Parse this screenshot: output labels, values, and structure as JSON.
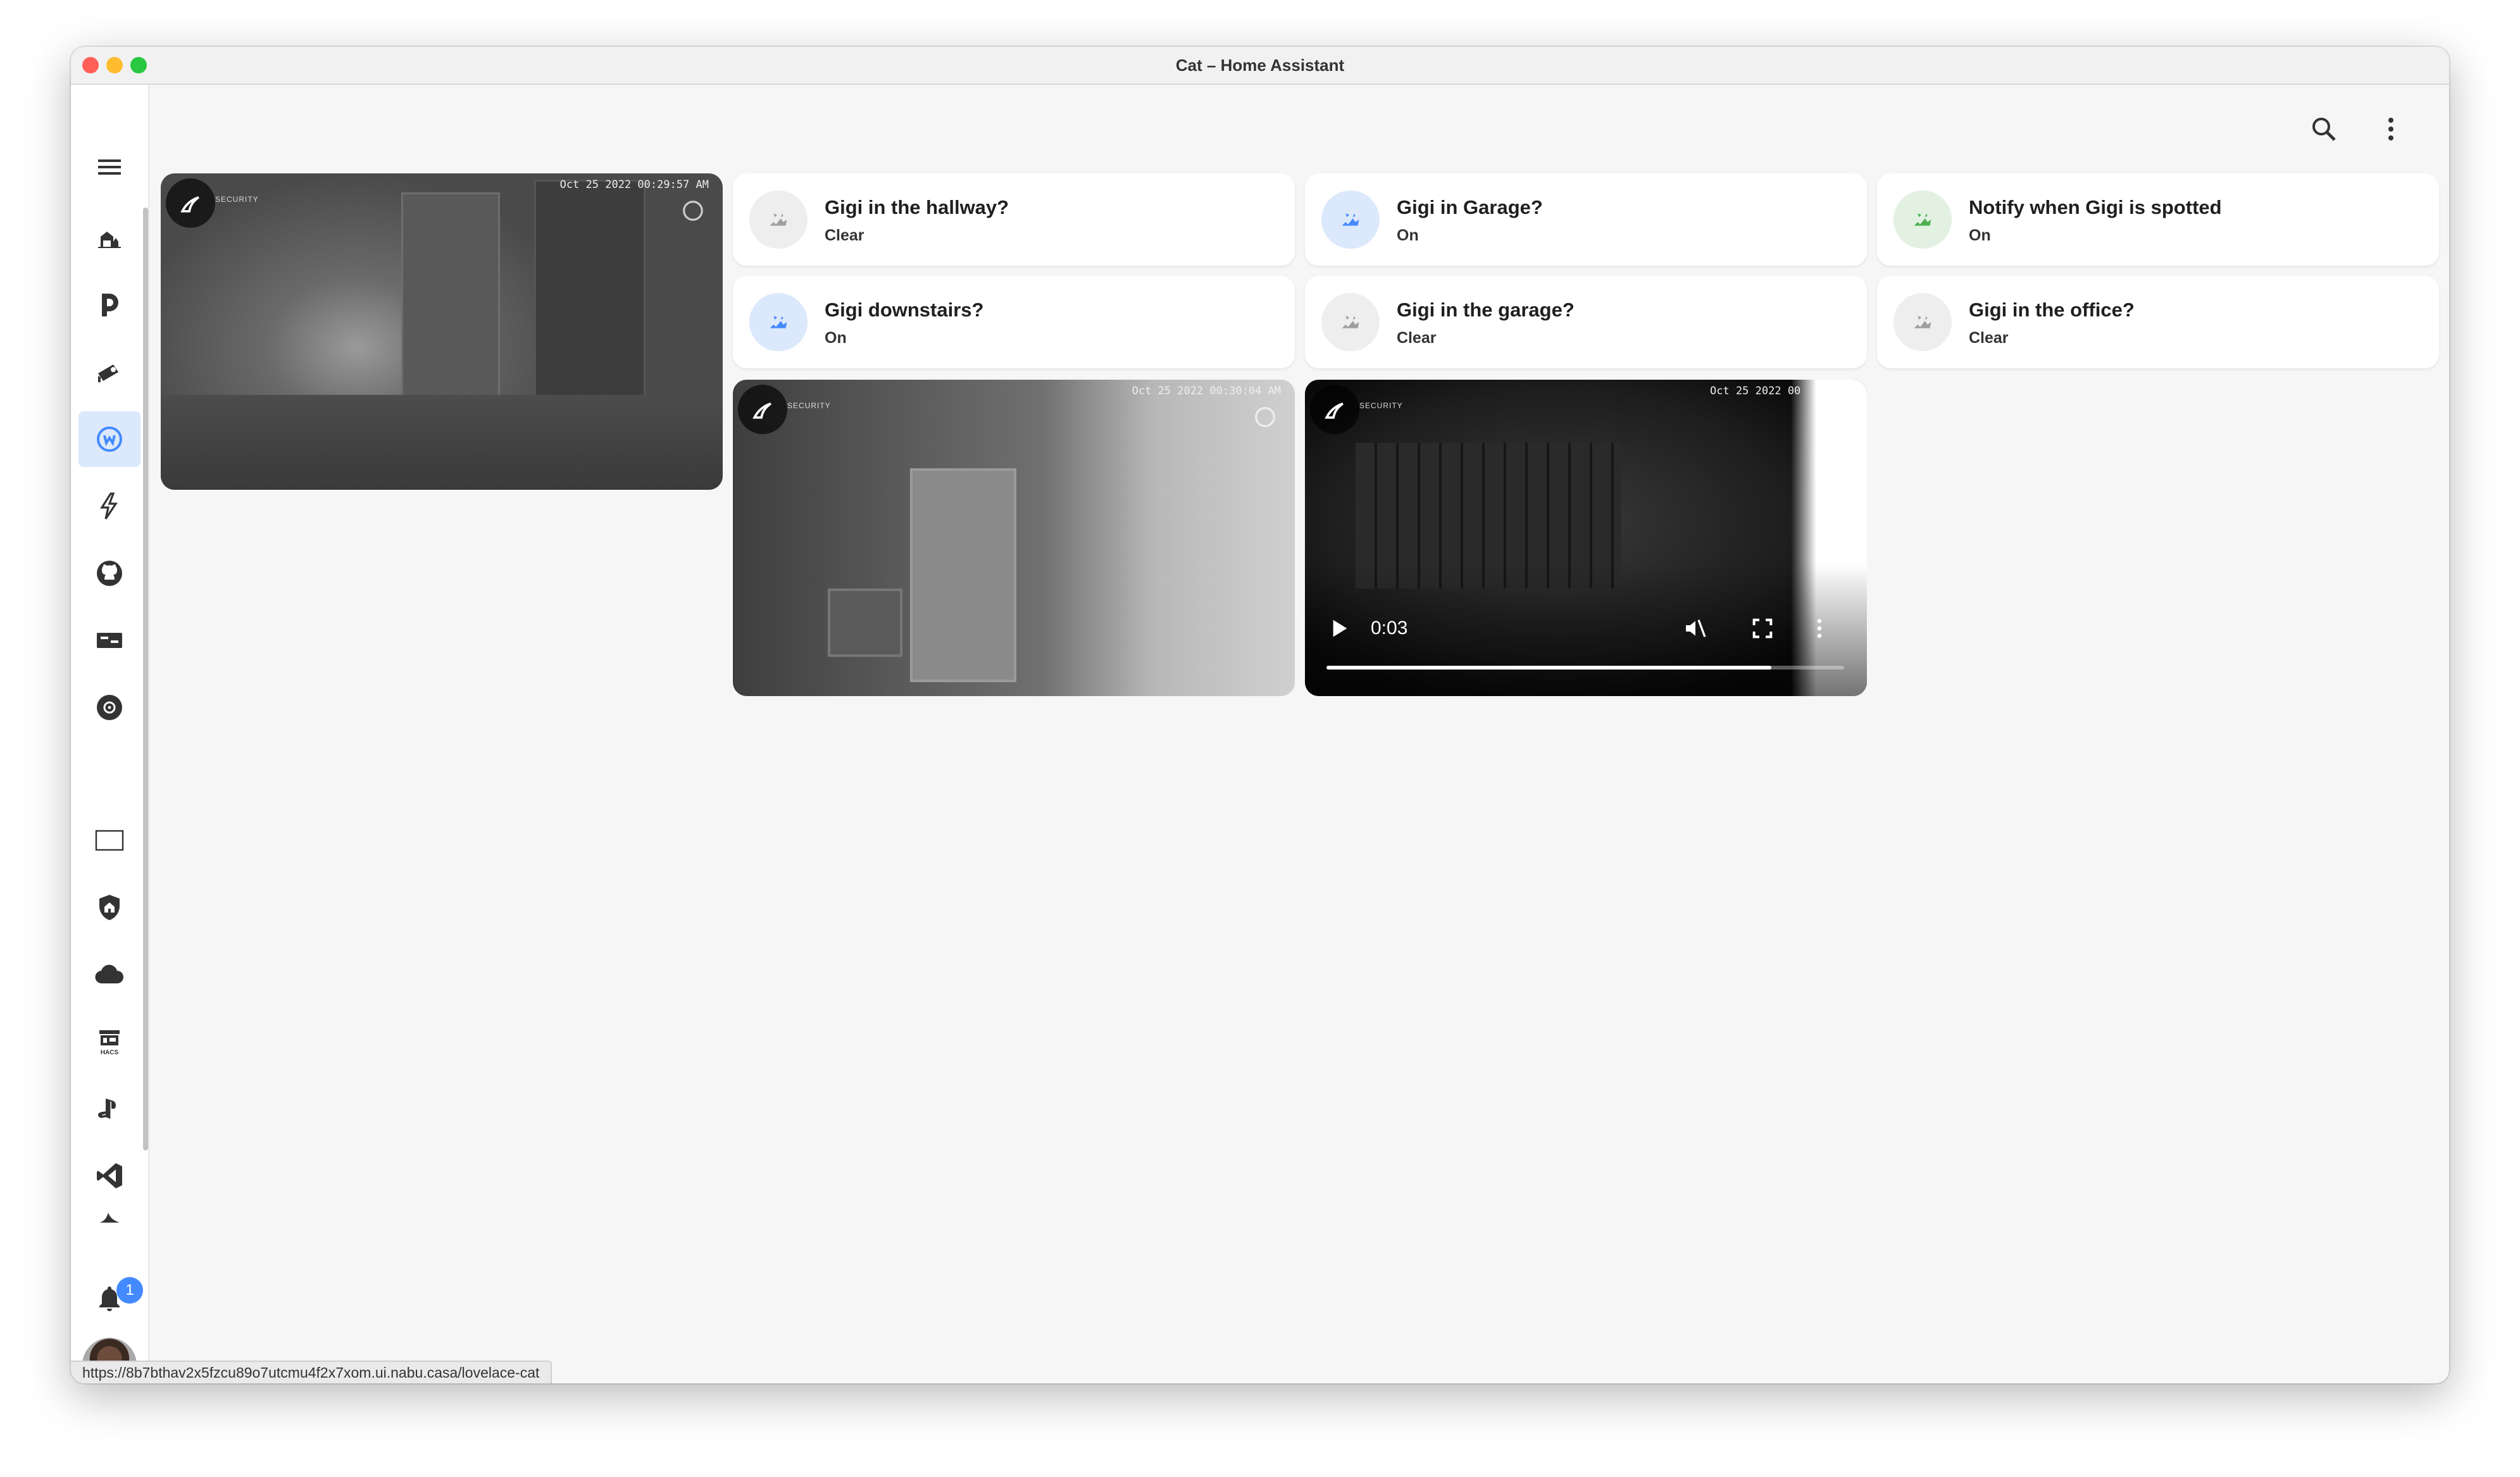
{
  "window": {
    "title": "Cat – Home Assistant"
  },
  "status_url": "https://8b7bthav2x5fzcu89o7utcmu4f2x7xom.ui.nabu.casa/lovelace-cat",
  "sidebar": {
    "menu_icon": "menu-icon",
    "items": [
      {
        "icon": "home-cat-icon"
      },
      {
        "icon": "plex-icon"
      },
      {
        "icon": "cctv-icon"
      },
      {
        "icon": "cat-dashboard-icon",
        "active": true
      },
      {
        "icon": "lightning-icon"
      },
      {
        "icon": "github-icon"
      },
      {
        "icon": "media-icon"
      },
      {
        "icon": "disc-icon"
      },
      {
        "icon": "monitor-icon"
      },
      {
        "icon": "shield-home-icon"
      },
      {
        "icon": "cloud-icon"
      },
      {
        "icon": "hacs-icon"
      },
      {
        "icon": "playstation-icon"
      },
      {
        "icon": "vscode-icon"
      },
      {
        "icon": "shark-icon"
      }
    ],
    "notifications": {
      "count": "1"
    }
  },
  "toolbar": {
    "search_icon": "search-icon",
    "more_icon": "more-vertical-icon"
  },
  "cameras": [
    {
      "timestamp": "Oct 25 2022  00:29:57 AM",
      "brand": "SECURITY"
    },
    {
      "timestamp": "Oct 25 2022  00:30:04 AM",
      "brand": "SECURITY"
    },
    {
      "timestamp": "Oct 25 2022  00",
      "brand": "SECURITY",
      "video": {
        "time": "0:03",
        "progress": 0.86
      }
    }
  ],
  "tiles": [
    {
      "name": "Gigi in the hallway?",
      "state": "Clear",
      "icon_color": "#9e9e9e",
      "icon_bg": "#eeeeee"
    },
    {
      "name": "Gigi in Garage?",
      "state": "On",
      "icon_color": "#448aff",
      "icon_bg": "#dce8fb"
    },
    {
      "name": "Notify when Gigi is spotted",
      "state": "On",
      "icon_color": "#4caf50",
      "icon_bg": "#e2f1e2"
    },
    {
      "name": "Gigi downstairs?",
      "state": "On",
      "icon_color": "#448aff",
      "icon_bg": "#dce8fb"
    },
    {
      "name": "Gigi in the garage?",
      "state": "Clear",
      "icon_color": "#9e9e9e",
      "icon_bg": "#eeeeee"
    },
    {
      "name": "Gigi in the office?",
      "state": "Clear",
      "icon_color": "#9e9e9e",
      "icon_bg": "#eeeeee"
    }
  ]
}
